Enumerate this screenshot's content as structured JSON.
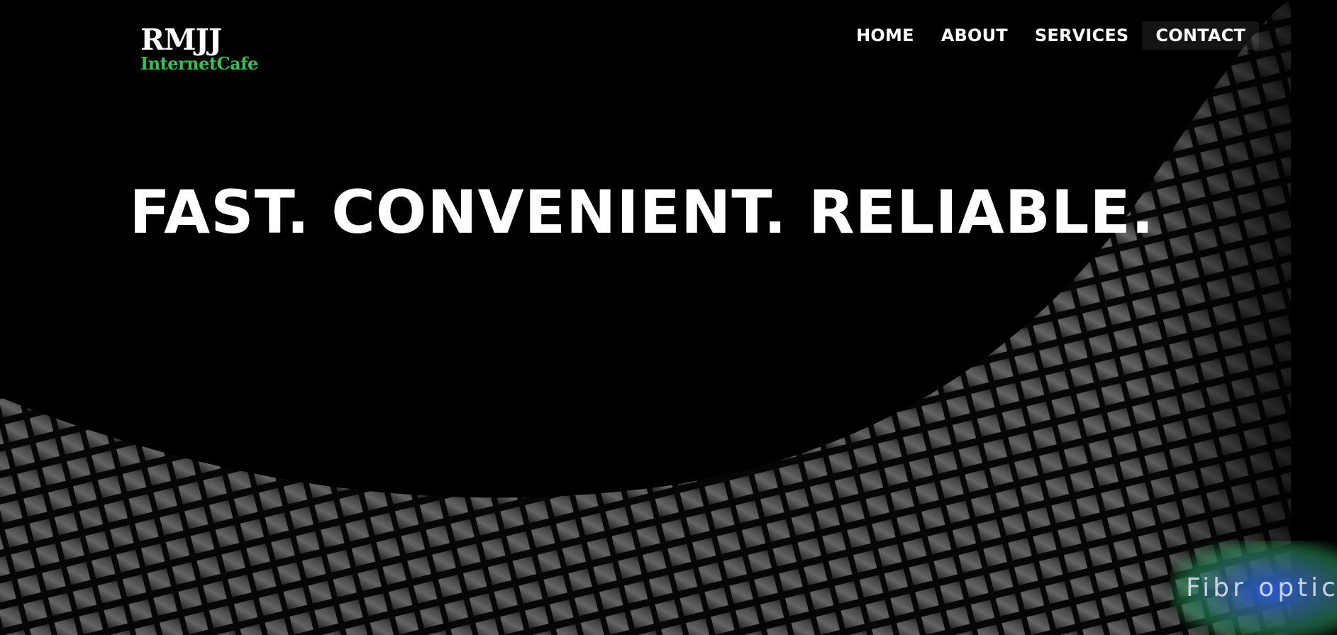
{
  "logo": {
    "line1": "RMJJ",
    "line2": "InternetCafe"
  },
  "nav": {
    "items": [
      {
        "label": "HOME"
      },
      {
        "label": "ABOUT"
      },
      {
        "label": "SERVICES"
      },
      {
        "label": "CONTACT"
      }
    ]
  },
  "hero": {
    "headline": "FAST. CONVENIENT. RELIABLE."
  },
  "promo": {
    "text": "Fibr optic"
  },
  "colors": {
    "background": "#000000",
    "brand_green": "#2ec44f",
    "text": "#ffffff"
  }
}
